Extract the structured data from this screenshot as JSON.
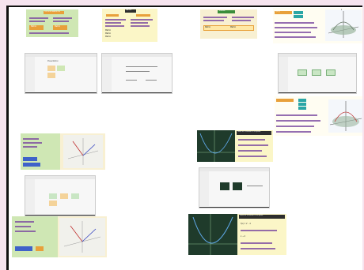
{
  "slides": {
    "s1": {
      "labels": [
        "TIPOS DE MATRICES",
        "Matriz",
        "Matriz"
      ]
    },
    "s2": {
      "labels": [
        "MATRIZ",
        "Matriz",
        "Matriz",
        "Matriz"
      ]
    },
    "s3": {
      "labels": [
        "Inversa",
        "Matriz",
        "Matriz"
      ]
    },
    "s4": {
      "labels": [
        "f(x,y)",
        "z"
      ]
    },
    "desktop": {
      "doc_title": "Presentation"
    },
    "math1": {
      "labels": [
        "Límite de la función en un punto",
        "f(x)",
        "x",
        "y"
      ]
    },
    "math2": {
      "labels": [
        "Límite de la función en un punto",
        "f(x) = x² - 4",
        "x → 2"
      ]
    }
  },
  "colors": {
    "background": "#f6e4ef",
    "orange_title": "#e8a03a",
    "green_bg": "#cfe7b4",
    "yellow_bg": "#fbf6c7",
    "cream_bg": "#f8f0d2",
    "dark_graph": "#1f3b2b",
    "taskbar": "#1b1b1b"
  }
}
